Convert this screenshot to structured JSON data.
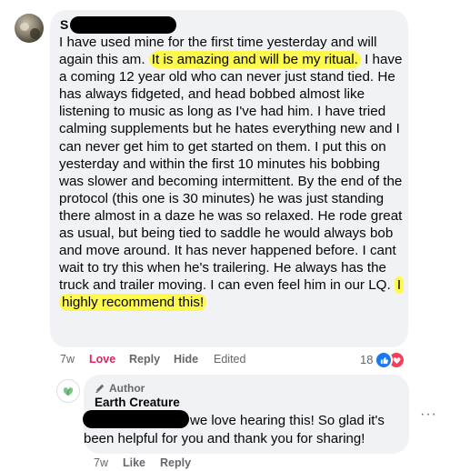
{
  "comment": {
    "author_initial": "S",
    "segments": [
      {
        "text": "I have used mine for the first time yesterday and will again this am. ",
        "highlight": false
      },
      {
        "text": "It is amazing and will be my ritual.",
        "highlight": true
      },
      {
        "text": " I have a coming 12 year old who can never just stand tied. He has always fidgeted, and head bobbed almost like listening to music as long as I've had him. I have tried calming supplements but he hates everything new and I can never get him to get started on them. I put this on yesterday and within the first 10 minutes his bobbing was slower and becoming intermittent. By the end of the protocol (this one is 30 minutes) he was just standing there almost in a daze he was so relaxed. He rode great as usual, but being tied to saddle he would always bob and move around. It has never happened before. I cant wait to try this when he's trailering. He always has the truck and trailer moving. I can even feel him in our LQ. ",
        "highlight": false
      },
      {
        "text": "I highly recommend this!",
        "highlight": true
      }
    ],
    "actions": {
      "time": "7w",
      "love": "Love",
      "reply": "Reply",
      "hide": "Hide",
      "edited": "Edited"
    },
    "reaction_count": "18",
    "reaction_icons": [
      "like-icon",
      "heart-icon"
    ]
  },
  "reply": {
    "badge": "Author",
    "name": "Earth Creature",
    "text": "we love hearing this! So glad it's been helpful for you and thank you for sharing!",
    "actions": {
      "time": "7w",
      "like": "Like",
      "reply": "Reply"
    },
    "more": "···"
  },
  "colors": {
    "bubble": "#f0f2f5",
    "highlight": "#fef94d",
    "love": "#e0245e",
    "like_blue": "#1877f2",
    "muted": "#65676b"
  }
}
